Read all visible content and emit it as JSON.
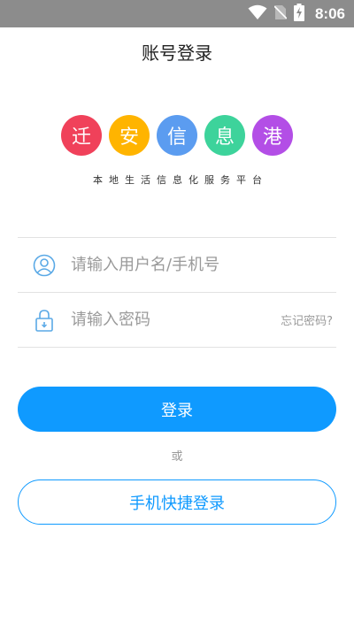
{
  "status_bar": {
    "time": "8:06",
    "icons": [
      "wifi-icon",
      "sim-none-icon",
      "battery-charging-icon"
    ]
  },
  "header": {
    "title": "账号登录"
  },
  "logo": {
    "chars": [
      {
        "char": "迁",
        "color": "#f0415a"
      },
      {
        "char": "安",
        "color": "#ffb400"
      },
      {
        "char": "信",
        "color": "#5b9cf0"
      },
      {
        "char": "息",
        "color": "#3dd39b"
      },
      {
        "char": "港",
        "color": "#b34ee6"
      }
    ],
    "tagline": "本地生活信息化服务平台"
  },
  "form": {
    "username": {
      "placeholder": "请输入用户名/手机号",
      "value": ""
    },
    "password": {
      "placeholder": "请输入密码",
      "value": ""
    },
    "forgot_label": "忘记密码?",
    "login_label": "登录",
    "or_label": "或",
    "phone_login_label": "手机快捷登录"
  },
  "colors": {
    "accent": "#0f9aff",
    "status_bar": "#8c8c8c",
    "icon": "#5aa9e6"
  }
}
